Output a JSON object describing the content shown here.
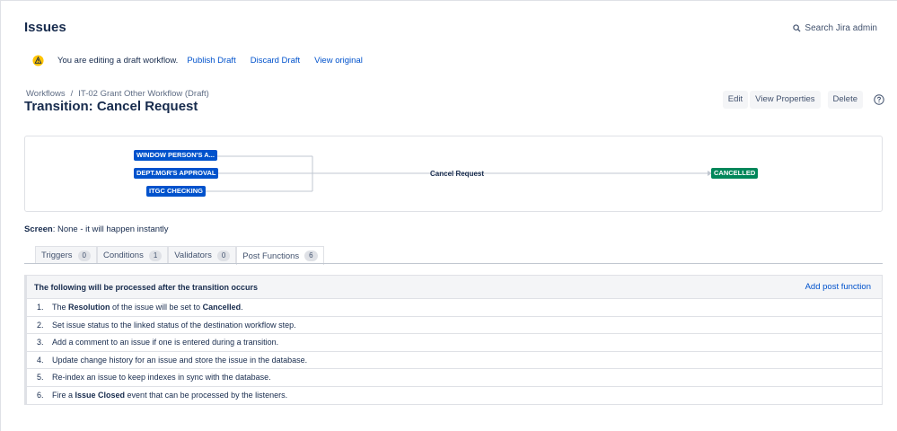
{
  "header": {
    "title": "Issues",
    "search_label": "Search Jira admin"
  },
  "draft_bar": {
    "message": "You are editing a draft workflow.",
    "publish": "Publish Draft",
    "discard": "Discard Draft",
    "view_original": "View original"
  },
  "breadcrumb": {
    "root": "Workflows",
    "separator": "/",
    "current": "IT-02 Grant Other Workflow (Draft)"
  },
  "transition": {
    "title": "Transition: Cancel Request"
  },
  "actions": {
    "edit": "Edit",
    "view_properties": "View Properties",
    "delete": "Delete"
  },
  "diagram": {
    "from_statuses": [
      "WINDOW PERSON'S A...",
      "DEPT.MGR'S APPROVAL",
      "ITGC CHECKING"
    ],
    "transition_name": "Cancel Request",
    "to_status": "CANCELLED",
    "colors": {
      "from": "#0052cc",
      "to": "#00875a"
    }
  },
  "screen": {
    "label": "Screen",
    "value": ": None - it will happen instantly"
  },
  "tabs": [
    {
      "label": "Triggers",
      "count": "0"
    },
    {
      "label": "Conditions",
      "count": "1"
    },
    {
      "label": "Validators",
      "count": "0"
    },
    {
      "label": "Post Functions",
      "count": "6"
    }
  ],
  "post_functions": {
    "heading": "The following will be processed after the transition occurs",
    "add_link": "Add post function",
    "items": [
      {
        "num": "1.",
        "pre": "The ",
        "b1": "Resolution",
        "mid": " of the issue will be set to ",
        "b2": "Cancelled",
        "post": "."
      },
      {
        "num": "2.",
        "text": "Set issue status to the linked status of the destination workflow step."
      },
      {
        "num": "3.",
        "text": "Add a comment to an issue if one is entered during a transition."
      },
      {
        "num": "4.",
        "text": "Update change history for an issue and store the issue in the database."
      },
      {
        "num": "5.",
        "text": "Re-index an issue to keep indexes in sync with the database."
      },
      {
        "num": "6.",
        "pre": "Fire a ",
        "b1": "Issue Closed",
        "post": " event that can be processed by the listeners."
      }
    ]
  }
}
